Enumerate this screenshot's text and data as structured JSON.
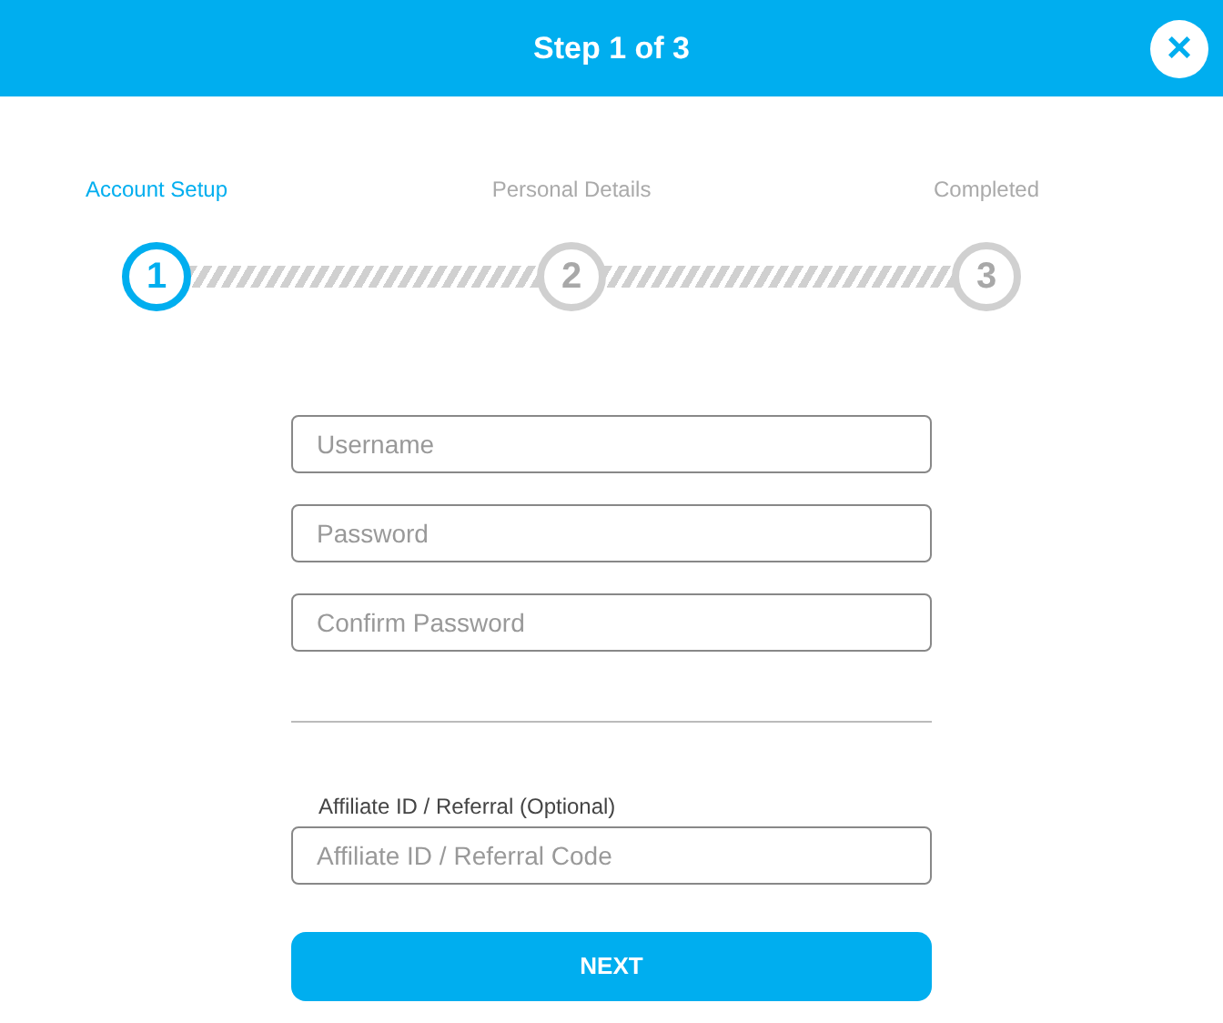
{
  "header": {
    "title": "Step 1 of 3",
    "close": "×"
  },
  "steps": [
    {
      "label": "Account Setup",
      "number": "1",
      "selected": true
    },
    {
      "label": "Personal Details",
      "number": "2",
      "selected": false
    },
    {
      "label": "Completed",
      "number": "3",
      "selected": false
    }
  ],
  "fields": [
    {
      "placeholder": "Username"
    },
    {
      "placeholder": "Password"
    },
    {
      "placeholder": "Confirm Password"
    }
  ],
  "affiliate": {
    "label": "Affiliate ID / Referral (Optional)",
    "placeholder": "Affiliate ID / Referral Code"
  },
  "button": "NEXT"
}
